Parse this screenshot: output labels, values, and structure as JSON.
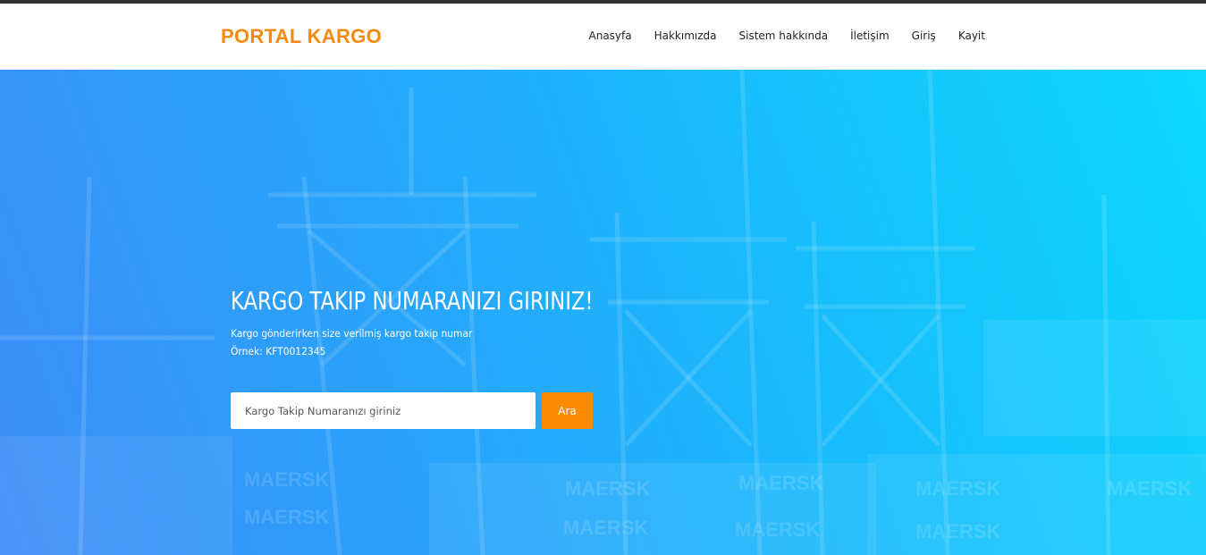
{
  "header": {
    "brand": "PORTAL KARGO",
    "nav": [
      {
        "label": "Anasyfa"
      },
      {
        "label": "Hakkımızda"
      },
      {
        "label": "Sistem hakkında"
      },
      {
        "label": "İletişim"
      },
      {
        "label": "Giriş"
      },
      {
        "label": "Kayit"
      }
    ]
  },
  "hero": {
    "title": "KARGO TAKIP NUMARANIZI GIRINIZ!",
    "description": "Kargo gönderirken size verilmiş kargo takip numar",
    "example": "Örnek: KFT0012345",
    "background_watermarks": [
      "MAERSK",
      "MAERSK",
      "MAERSK",
      "MAERSK",
      "MAERSK",
      "MAERSK",
      "MAERSK",
      "MAERSK",
      "MAERSK"
    ]
  },
  "search": {
    "placeholder": "Kargo Takip Numaranızı giriniz",
    "value": "",
    "button_label": "Ara"
  },
  "colors": {
    "brand": "#f7890c",
    "button": "#fb8c00",
    "hero_gradient_start": "#3d8cf6",
    "hero_gradient_end": "#0cd8fc",
    "topbar": "#333333"
  }
}
